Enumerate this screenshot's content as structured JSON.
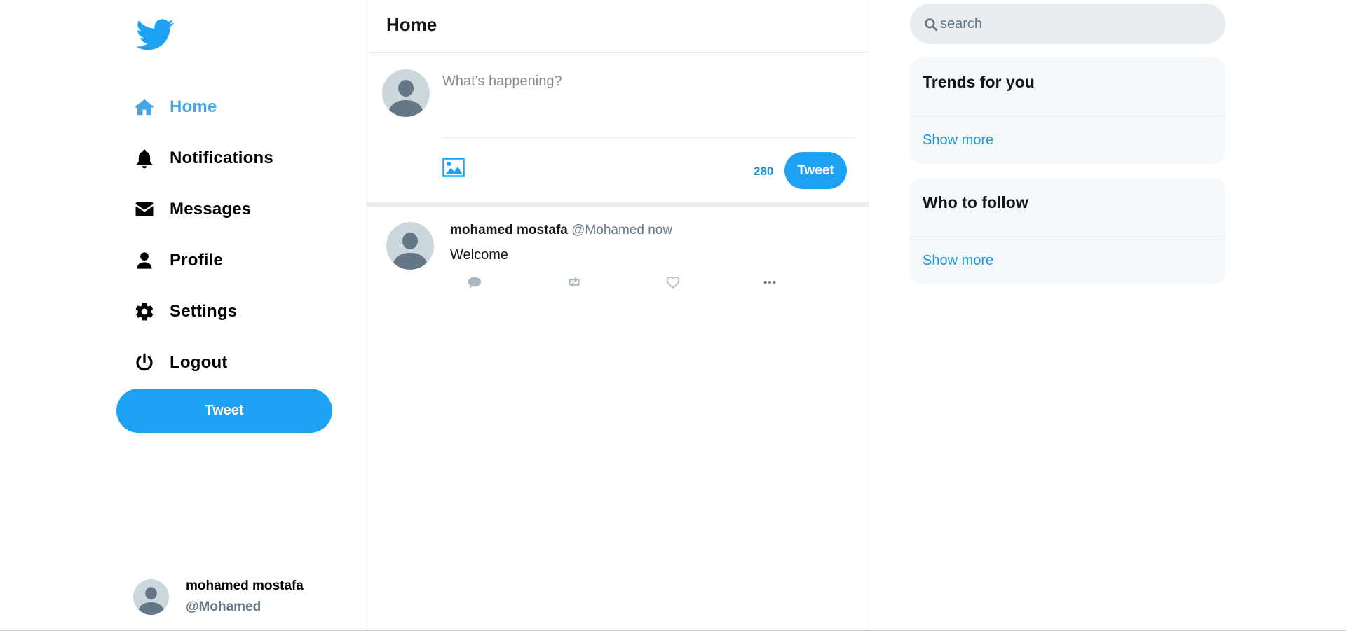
{
  "colors": {
    "brand": "#1da1f2",
    "active_nav": "#4aa6e0",
    "link": "#1b95e0",
    "muted": "#657786",
    "border": "#e6ecf0"
  },
  "sidebar": {
    "logo_icon": "twitter-bird-icon",
    "items": [
      {
        "label": "Home",
        "icon": "home-icon",
        "active": true
      },
      {
        "label": "Notifications",
        "icon": "bell-icon"
      },
      {
        "label": "Messages",
        "icon": "envelope-icon"
      },
      {
        "label": "Profile",
        "icon": "user-icon"
      },
      {
        "label": "Settings",
        "icon": "gear-icon"
      },
      {
        "label": "Logout",
        "icon": "power-icon"
      }
    ],
    "tweet_label": "Tweet",
    "account": {
      "name": "mohamed mostafa",
      "handle": "@Mohamed"
    }
  },
  "feed": {
    "title": "Home",
    "composer": {
      "placeholder": "What's happening?",
      "remaining": "280",
      "tweet_label": "Tweet"
    },
    "tweets": [
      {
        "name": "mohamed mostafa",
        "handle": "@Mohamed",
        "time": "now",
        "text": "Welcome"
      }
    ]
  },
  "right": {
    "search_placeholder": "search",
    "trends": {
      "title": "Trends for you",
      "show_more": "Show more"
    },
    "follow": {
      "title": "Who to follow",
      "show_more": "Show more"
    }
  }
}
